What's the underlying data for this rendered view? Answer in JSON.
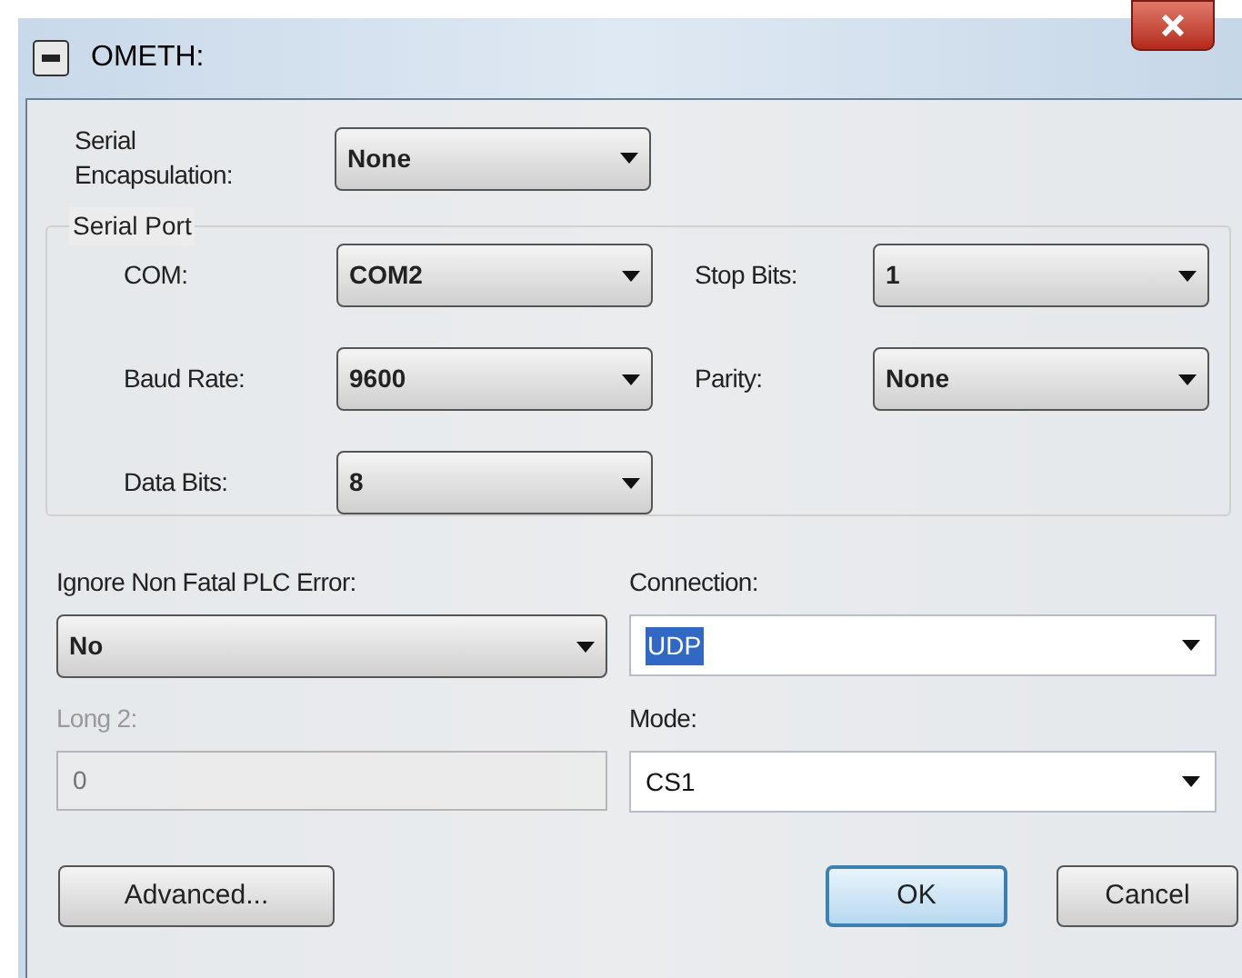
{
  "window": {
    "title": "OMETH:"
  },
  "serial_encapsulation": {
    "label": "Serial Encapsulation:",
    "value": "None",
    "kind": "combo"
  },
  "serial_port": {
    "title": "Serial Port",
    "fields": [
      {
        "label": "COM:",
        "value": "COM2",
        "kind": "combo"
      },
      {
        "label": "Stop Bits:",
        "value": "1",
        "kind": "combo"
      },
      {
        "label": "Baud Rate:",
        "value": "9600",
        "kind": "combo"
      },
      {
        "label": "Parity:",
        "value": "None",
        "kind": "combo"
      },
      {
        "label": "Data Bits:",
        "value": "8",
        "kind": "combo"
      }
    ]
  },
  "fields": [
    {
      "label": "Ignore Non Fatal PLC Error:",
      "value": "No",
      "kind": "combo",
      "disabled": false,
      "text_selected": false
    },
    {
      "label": "Connection:",
      "value": "UDP",
      "kind": "editable",
      "disabled": false,
      "text_selected": true
    },
    {
      "label": "Long 2:",
      "value": "0",
      "kind": "text",
      "disabled": true,
      "text_selected": false
    },
    {
      "label": "Mode:",
      "value": "CS1",
      "kind": "editable",
      "disabled": false,
      "text_selected": false
    }
  ],
  "buttons": [
    {
      "label": "Advanced...",
      "default": false
    },
    {
      "label": "OK",
      "default": true
    },
    {
      "label": "Cancel",
      "default": false
    }
  ]
}
